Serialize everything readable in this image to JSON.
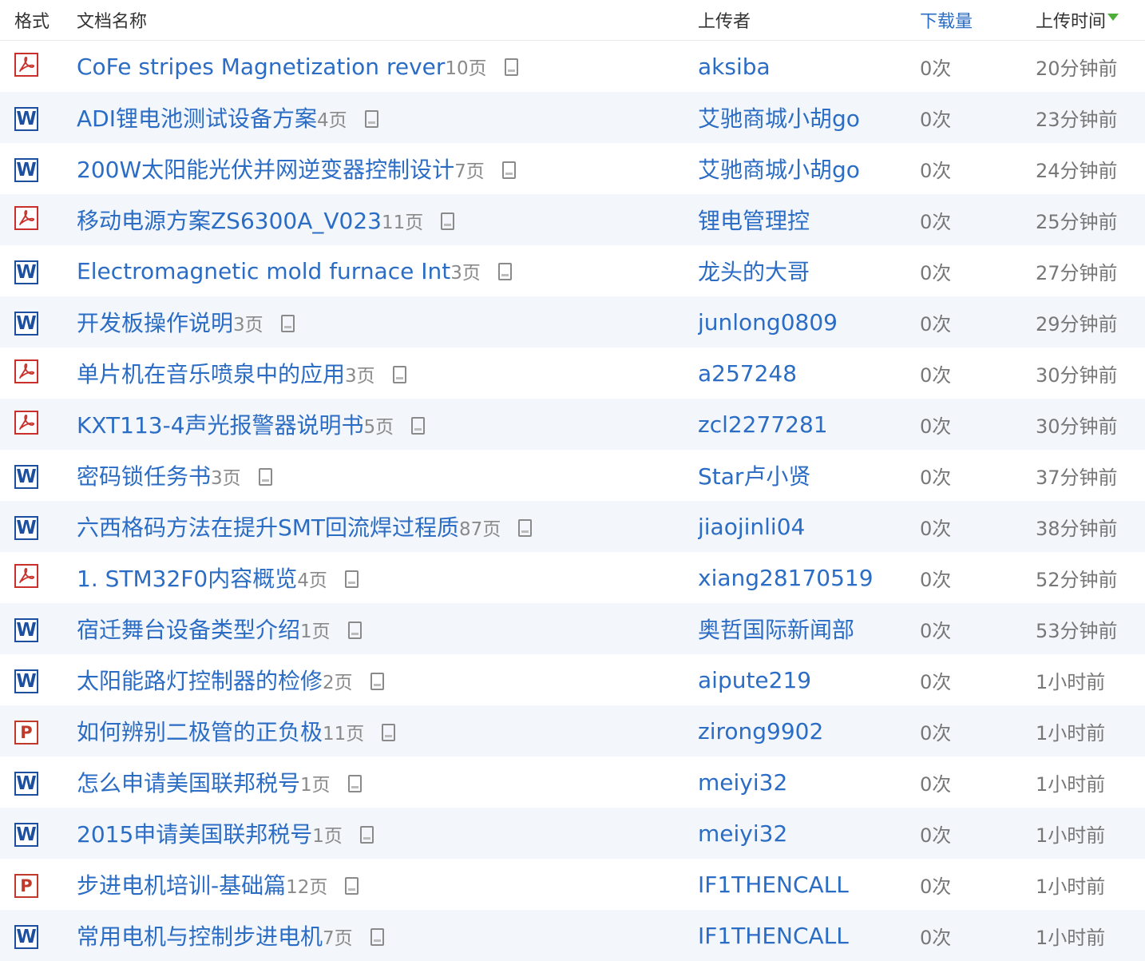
{
  "header": {
    "format": "格式",
    "name": "文档名称",
    "uploader": "上传者",
    "downloads": "下载量",
    "time": "上传时间"
  },
  "rows": [
    {
      "format": "pdf",
      "title": "CoFe stripes Magnetization rever",
      "pages": "10页",
      "uploader": "aksiba",
      "downloads": "0次",
      "time": "20分钟前"
    },
    {
      "format": "word",
      "title": "ADI锂电池测试设备方案",
      "pages": "4页",
      "uploader": "艾驰商城小胡go",
      "downloads": "0次",
      "time": "23分钟前"
    },
    {
      "format": "word",
      "title": "200W太阳能光伏并网逆变器控制设计",
      "pages": "7页",
      "uploader": "艾驰商城小胡go",
      "downloads": "0次",
      "time": "24分钟前"
    },
    {
      "format": "pdf",
      "title": "移动电源方案ZS6300A_V023",
      "pages": "11页",
      "uploader": "锂电管理控",
      "downloads": "0次",
      "time": "25分钟前"
    },
    {
      "format": "word",
      "title": "Electromagnetic mold furnace Int",
      "pages": "3页",
      "uploader": "龙头的大哥",
      "downloads": "0次",
      "time": "27分钟前"
    },
    {
      "format": "word",
      "title": "开发板操作说明",
      "pages": "3页",
      "uploader": "junlong0809",
      "downloads": "0次",
      "time": "29分钟前"
    },
    {
      "format": "pdf",
      "title": "单片机在音乐喷泉中的应用",
      "pages": "3页",
      "uploader": "a257248",
      "downloads": "0次",
      "time": "30分钟前"
    },
    {
      "format": "pdf",
      "title": "KXT113-4声光报警器说明书",
      "pages": "5页",
      "uploader": "zcl2277281",
      "downloads": "0次",
      "time": "30分钟前"
    },
    {
      "format": "word",
      "title": "密码锁任务书",
      "pages": "3页",
      "uploader": "Star卢小贤",
      "downloads": "0次",
      "time": "37分钟前"
    },
    {
      "format": "word",
      "title": "六西格码方法在提升SMT回流焊过程质",
      "pages": "87页",
      "uploader": "jiaojinli04",
      "downloads": "0次",
      "time": "38分钟前"
    },
    {
      "format": "pdf",
      "title": "1. STM32F0内容概览",
      "pages": "4页",
      "uploader": "xiang28170519",
      "downloads": "0次",
      "time": "52分钟前"
    },
    {
      "format": "word",
      "title": "宿迁舞台设备类型介绍",
      "pages": "1页",
      "uploader": "奥哲国际新闻部",
      "downloads": "0次",
      "time": "53分钟前"
    },
    {
      "format": "word",
      "title": "太阳能路灯控制器的检修",
      "pages": "2页",
      "uploader": "aipute219",
      "downloads": "0次",
      "time": "1小时前"
    },
    {
      "format": "ppt",
      "title": "如何辨别二极管的正负极",
      "pages": "11页",
      "uploader": "zirong9902",
      "downloads": "0次",
      "time": "1小时前"
    },
    {
      "format": "word",
      "title": "怎么申请美国联邦税号",
      "pages": "1页",
      "uploader": "meiyi32",
      "downloads": "0次",
      "time": "1小时前"
    },
    {
      "format": "word",
      "title": "2015申请美国联邦税号",
      "pages": "1页",
      "uploader": "meiyi32",
      "downloads": "0次",
      "time": "1小时前"
    },
    {
      "format": "ppt",
      "title": "步进电机培训-基础篇",
      "pages": "12页",
      "uploader": "IF1THENCALL",
      "downloads": "0次",
      "time": "1小时前"
    },
    {
      "format": "word",
      "title": "常用电机与控制步进电机",
      "pages": "7页",
      "uploader": "IF1THENCALL",
      "downloads": "0次",
      "time": "1小时前"
    }
  ],
  "colors": {
    "link": "#2b6cc4",
    "row_alt_bg": "#f3f7fb",
    "sort_arrow": "#4caf3a",
    "pdf_icon": "#c9302c",
    "word_icon": "#1d4fa0",
    "ppt_icon": "#c0392b"
  },
  "icons": {
    "pdf": "pdf-icon",
    "word": "word-icon",
    "ppt": "ppt-icon",
    "preview": "preview-icon",
    "sort": "sort-down-arrow-icon"
  }
}
